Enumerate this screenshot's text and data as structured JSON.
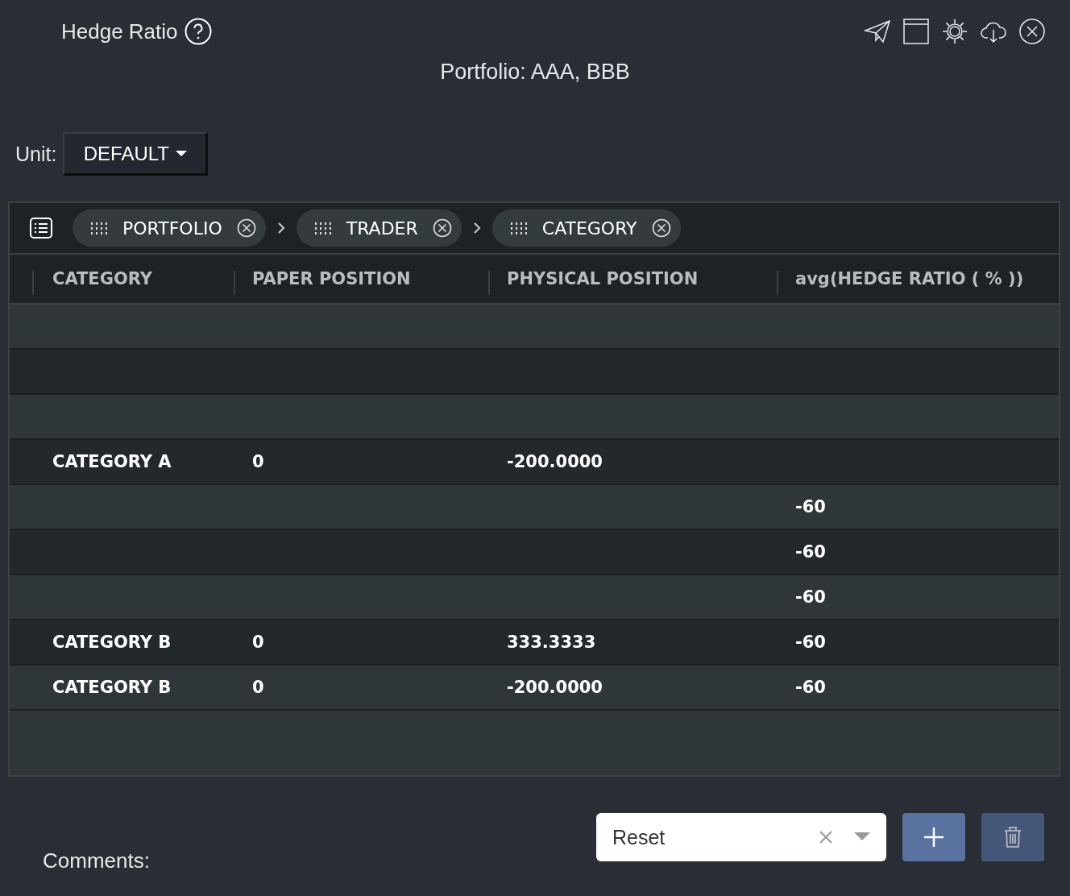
{
  "header": {
    "title": "Hedge Ratio",
    "subtitle": "Portfolio: AAA, BBB"
  },
  "unit": {
    "label": "Unit:",
    "value": "DEFAULT"
  },
  "groups": [
    {
      "label": "PORTFOLIO"
    },
    {
      "label": "TRADER"
    },
    {
      "label": "CATEGORY"
    }
  ],
  "table": {
    "columns": [
      "CATEGORY",
      "PAPER POSITION",
      "PHYSICAL POSITION",
      "avg(HEDGE RATIO ( % ))"
    ],
    "rows": [
      [
        "",
        "",
        "",
        ""
      ],
      [
        "",
        "",
        "",
        ""
      ],
      [
        "",
        "",
        "",
        ""
      ],
      [
        "CATEGORY A",
        "0",
        "-200.0000",
        ""
      ],
      [
        "",
        "",
        "",
        "-60"
      ],
      [
        "",
        "",
        "",
        "-60"
      ],
      [
        "",
        "",
        "",
        "-60"
      ],
      [
        "CATEGORY B",
        "0",
        "333.3333",
        "-60"
      ],
      [
        "CATEGORY B",
        "0",
        "-200.0000",
        "-60"
      ]
    ]
  },
  "footer": {
    "comments_label": "Comments:",
    "select_value": "Reset",
    "add_disabled": false,
    "delete_disabled": true
  }
}
